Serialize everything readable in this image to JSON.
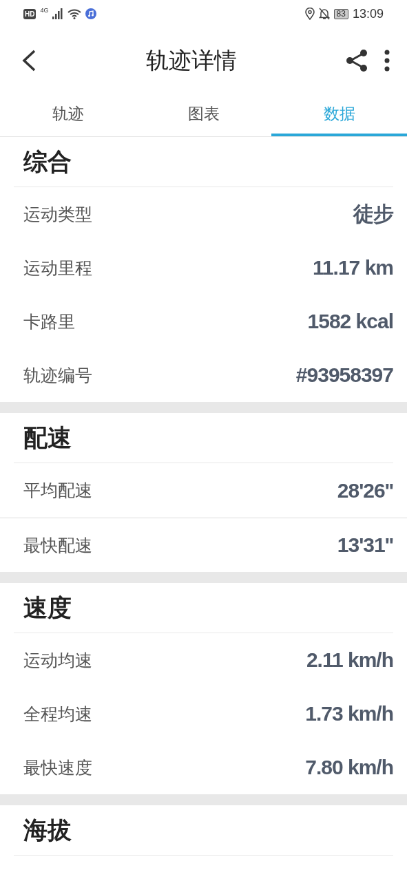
{
  "status_bar": {
    "hd": "HD",
    "network": "4G",
    "battery": "83",
    "time": "13:09"
  },
  "header": {
    "title": "轨迹详情"
  },
  "tabs": [
    {
      "label": "轨迹",
      "selected": false
    },
    {
      "label": "图表",
      "selected": false
    },
    {
      "label": "数据",
      "selected": true
    }
  ],
  "sections": [
    {
      "title": "综合",
      "rows": [
        {
          "label": "运动类型",
          "value": "徒步",
          "divided": false
        },
        {
          "label": "运动里程",
          "value": "11.17 km",
          "divided": false
        },
        {
          "label": "卡路里",
          "value": "1582 kcal",
          "divided": false
        },
        {
          "label": "轨迹编号",
          "value": "#93958397",
          "divided": false
        }
      ]
    },
    {
      "title": "配速",
      "rows": [
        {
          "label": "平均配速",
          "value": "28'26''",
          "divided": true
        },
        {
          "label": "最快配速",
          "value": "13'31''",
          "divided": false
        }
      ]
    },
    {
      "title": "速度",
      "rows": [
        {
          "label": "运动均速",
          "value": "2.11 km/h",
          "divided": false
        },
        {
          "label": "全程均速",
          "value": "1.73 km/h",
          "divided": false
        },
        {
          "label": "最快速度",
          "value": "7.80 km/h",
          "divided": false
        }
      ]
    },
    {
      "title": "海拔"
    }
  ]
}
